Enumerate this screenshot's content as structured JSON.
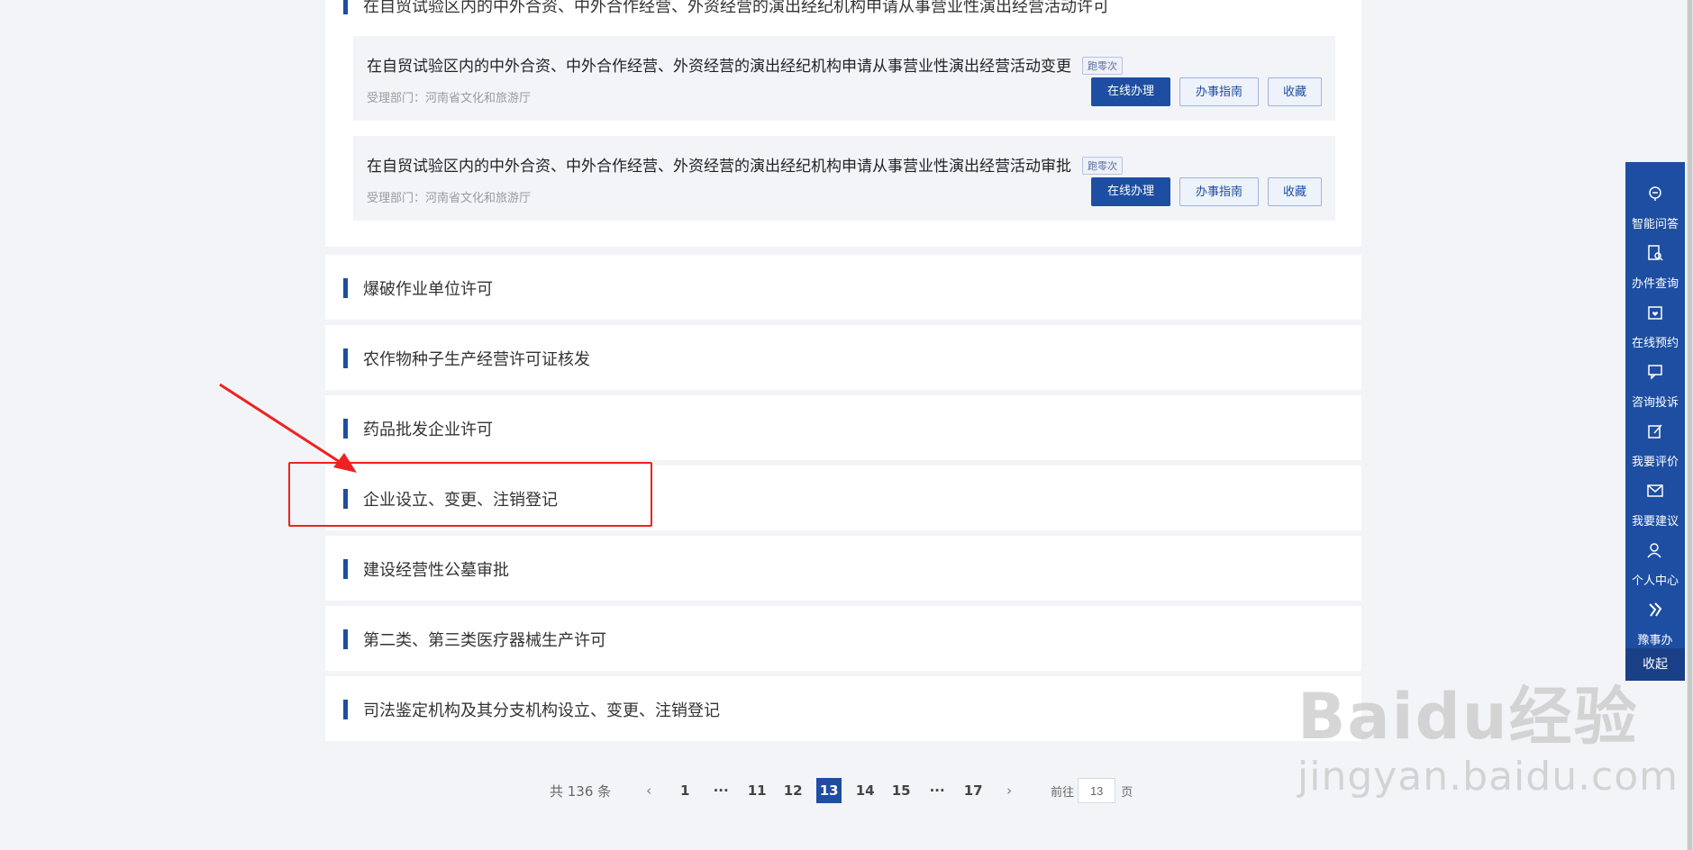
{
  "top_section": {
    "title": "在自贸试验区内的中外合资、中外合作经营、外资经营的演出经纪机构申请从事营业性演出经营活动许可",
    "sub_items": [
      {
        "title": "在自贸试验区内的中外合资、中外合作经营、外资经营的演出经纪机构申请从事营业性演出经营活动变更",
        "tag": "跑零次",
        "dept": "受理部门：河南省文化和旅游厅",
        "online_btn": "在线办理",
        "guide_btn": "办事指南",
        "fav_btn": "收藏"
      },
      {
        "title": "在自贸试验区内的中外合资、中外合作经营、外资经营的演出经纪机构申请从事营业性演出经营活动审批",
        "tag": "跑零次",
        "dept": "受理部门：河南省文化和旅游厅",
        "online_btn": "在线办理",
        "guide_btn": "办事指南",
        "fav_btn": "收藏"
      }
    ]
  },
  "items": [
    {
      "label": "爆破作业单位许可"
    },
    {
      "label": "农作物种子生产经营许可证核发"
    },
    {
      "label": "药品批发企业许可"
    },
    {
      "label": "企业设立、变更、注销登记"
    },
    {
      "label": "建设经营性公墓审批"
    },
    {
      "label": "第二类、第三类医疗器械生产许可"
    },
    {
      "label": "司法鉴定机构及其分支机构设立、变更、注销登记"
    }
  ],
  "pagination": {
    "total": "共 136 条",
    "prev": "‹",
    "next": "›",
    "ellipsis": "···",
    "pages": [
      "1",
      "11",
      "12",
      "13",
      "14",
      "15",
      "17"
    ],
    "current": "13",
    "goto_prefix": "前往",
    "goto_value": "13",
    "goto_suffix": "页"
  },
  "sidebar": {
    "items": [
      {
        "label": "智能问答",
        "icon": "robot-icon"
      },
      {
        "label": "办件查询",
        "icon": "document-search-icon"
      },
      {
        "label": "在线预约",
        "icon": "calendar-heart-icon"
      },
      {
        "label": "咨询投诉",
        "icon": "chat-icon"
      },
      {
        "label": "我要评价",
        "icon": "edit-icon"
      },
      {
        "label": "我要建议",
        "icon": "mail-icon"
      },
      {
        "label": "个人中心",
        "icon": "user-icon"
      },
      {
        "label": "豫事办",
        "icon": "yushiban-logo-icon"
      }
    ],
    "collapse_label": "收起"
  },
  "watermark": {
    "logo": "Baidu经验",
    "url": "jingyan.baidu.com"
  },
  "colors": {
    "primary": "#1d4ea1",
    "highlight": "#ee2222",
    "background": "#f3f4f7"
  }
}
